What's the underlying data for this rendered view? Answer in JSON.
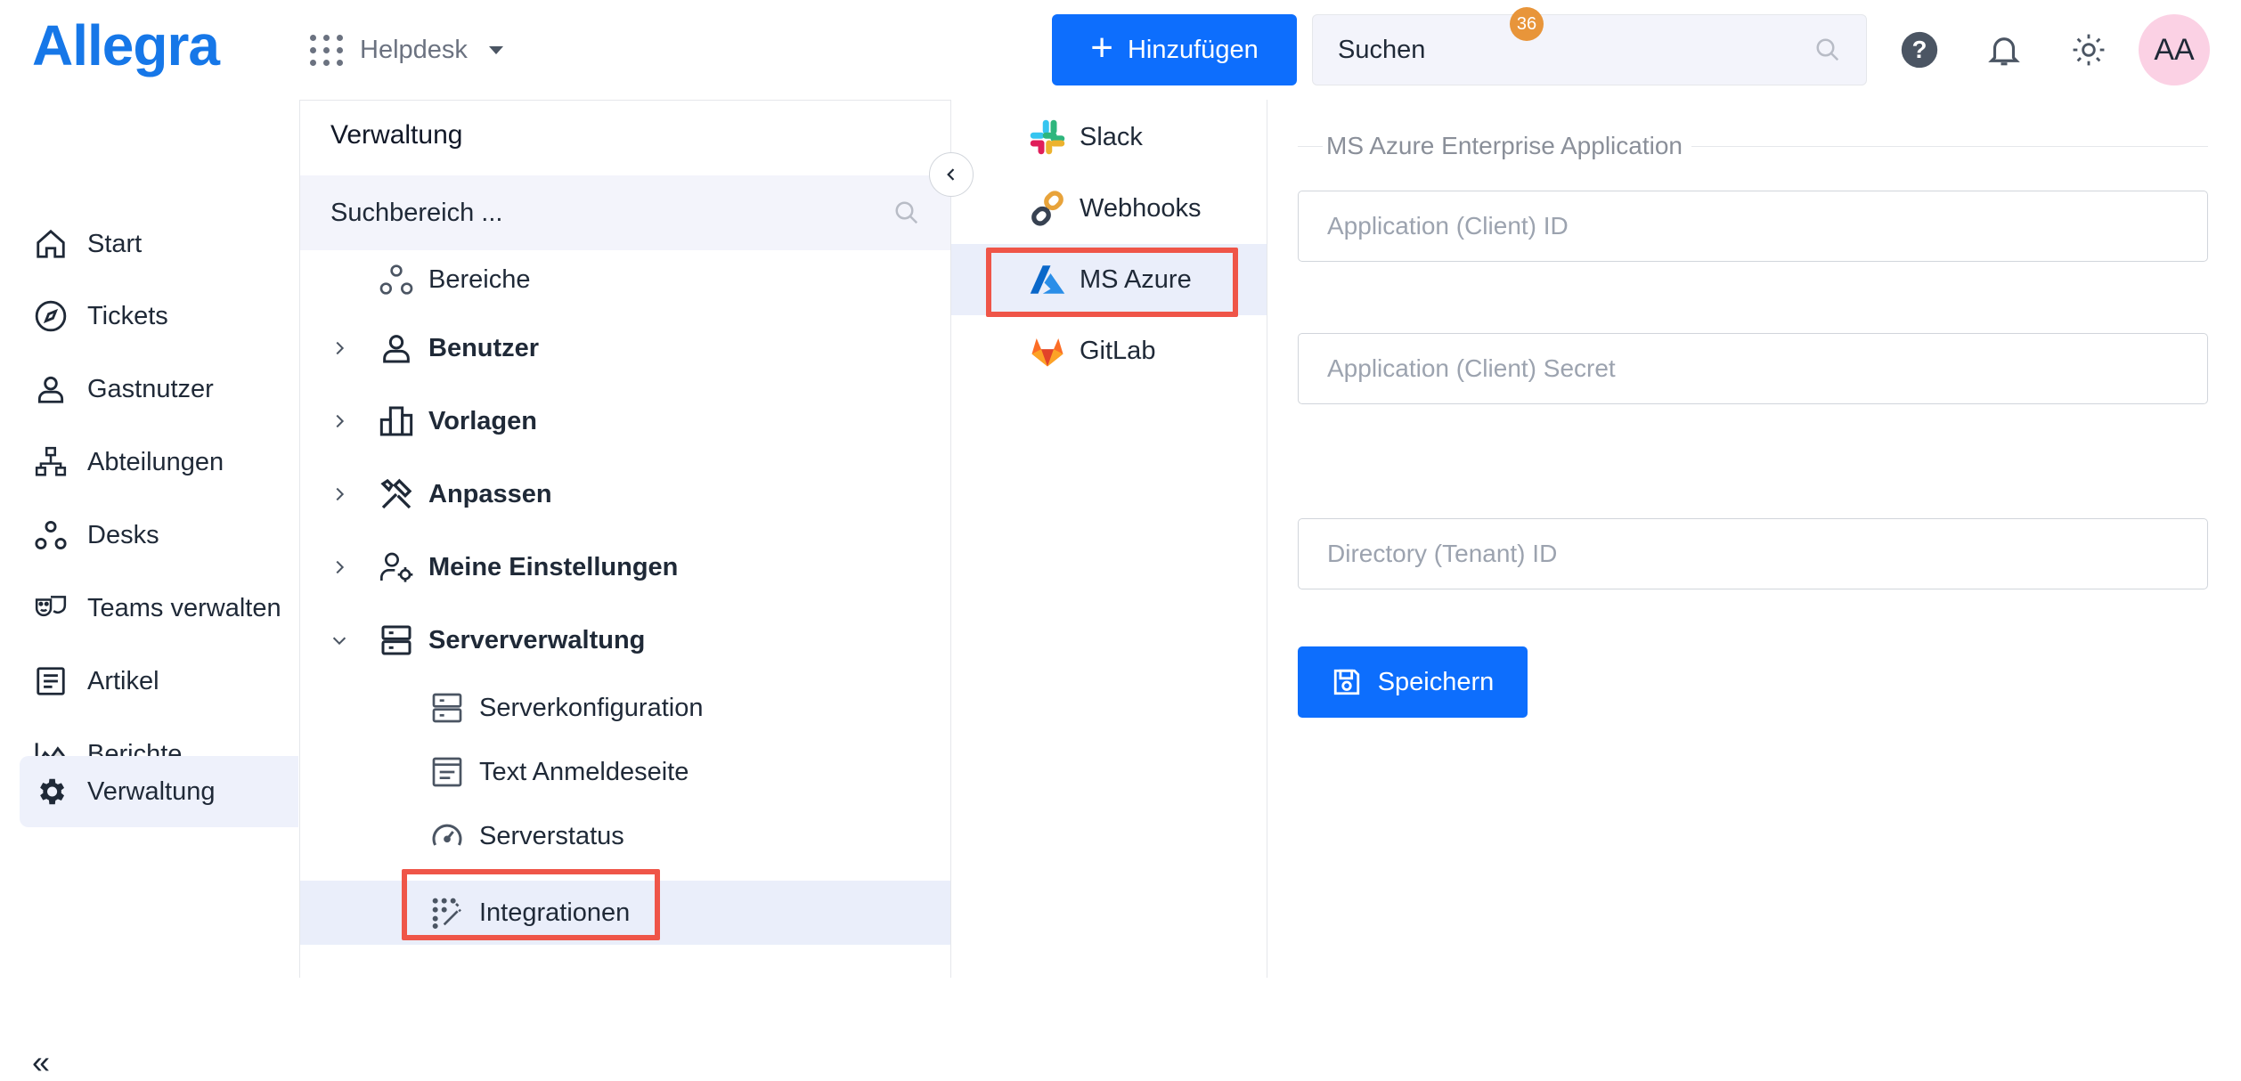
{
  "header": {
    "logo": "Allegra",
    "app_switcher": "Helpdesk",
    "add_button": "Hinzufügen",
    "search_placeholder": "Suchen",
    "notification_count": "36",
    "avatar_initials": "AA"
  },
  "leftnav": {
    "items": [
      {
        "label": "Start",
        "icon": "home-icon"
      },
      {
        "label": "Tickets",
        "icon": "compass-icon"
      },
      {
        "label": "Gastnutzer",
        "icon": "user-icon"
      },
      {
        "label": "Abteilungen",
        "icon": "org-chart-icon"
      },
      {
        "label": "Desks",
        "icon": "circles-icon"
      },
      {
        "label": "Teams verwalten",
        "icon": "masks-icon"
      },
      {
        "label": "Artikel",
        "icon": "article-icon"
      },
      {
        "label": "Berichte",
        "icon": "chart-area-icon"
      },
      {
        "label": "Verwaltung",
        "icon": "gear-icon",
        "active": true
      }
    ],
    "collapse_glyph": "«"
  },
  "tree": {
    "title": "Verwaltung",
    "search_placeholder": "Suchbereich ...",
    "items": [
      {
        "label": "Bereiche"
      },
      {
        "label": "Benutzer"
      },
      {
        "label": "Vorlagen"
      },
      {
        "label": "Anpassen"
      },
      {
        "label": "Meine Einstellungen"
      },
      {
        "label": "Serververwaltung"
      },
      {
        "label": "Serverkonfiguration"
      },
      {
        "label": "Text Anmeldeseite"
      },
      {
        "label": "Serverstatus"
      },
      {
        "label": "Integrationen",
        "selected": true
      }
    ]
  },
  "integrations": {
    "items": [
      {
        "label": "Slack"
      },
      {
        "label": "Webhooks"
      },
      {
        "label": "MS Azure",
        "selected": true
      },
      {
        "label": "GitLab"
      }
    ]
  },
  "form": {
    "legend": "MS Azure Enterprise Application",
    "client_id_placeholder": "Application (Client) ID",
    "client_secret_placeholder": "Application (Client) Secret",
    "tenant_id_placeholder": "Directory (Tenant) ID",
    "save_label": "Speichern"
  },
  "colors": {
    "primary": "#0d6efd",
    "highlight": "#ef5548",
    "badge": "#e8953a",
    "avatar_bg": "#fbd1e4",
    "selected_bg": "#eaeefa"
  }
}
